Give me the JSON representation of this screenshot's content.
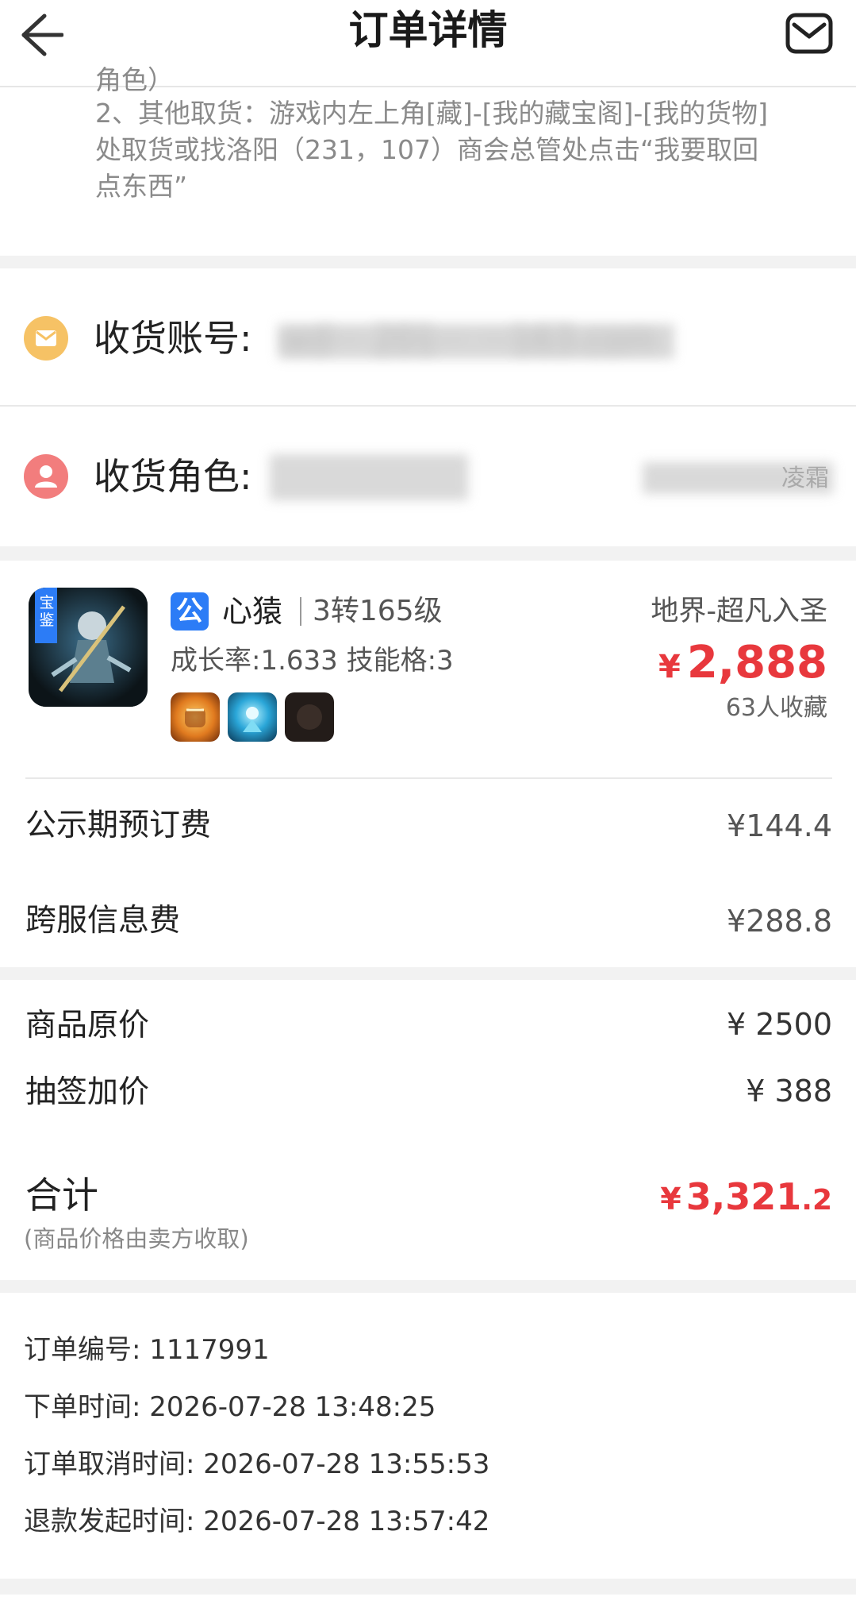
{
  "header": {
    "title": "订单详情"
  },
  "notes": {
    "line0": "角色）",
    "line1": "2、其他取货：游戏内左上角[藏]-[我的藏宝阁]-[我的货物]",
    "line2": "处取货或找洛阳（231，107）商会总管处点击“我要取回",
    "line3": "点东西”"
  },
  "receiver": {
    "account_label": "收货账号:",
    "account_value": "wd··· 201··· ···163.com",
    "role_label": "收货角色:",
    "role_value_tail": "凌霜"
  },
  "product": {
    "badge": "公",
    "name": "心猿",
    "level": "3转165级",
    "server": "地界-超凡入圣",
    "stats": "成长率:1.633 技能格:3",
    "price_symbol": "¥",
    "price": "2,888",
    "favorites": "63人收藏",
    "thumb_tag": "宝鉴",
    "skill_icons": [
      "fist-skill-icon",
      "ice-skill-icon",
      "dark-skill-icon"
    ]
  },
  "fees": [
    {
      "label": "公示期预订费",
      "value": "¥144.4"
    },
    {
      "label": "跨服信息费",
      "value": "¥288.8"
    }
  ],
  "pricing": {
    "original_label": "商品原价",
    "original_value": "¥ 2500",
    "lottery_label": "抽签加价",
    "lottery_value": "¥ 388"
  },
  "total": {
    "label": "合计",
    "note": "(商品价格由卖方收取)",
    "symbol": "¥",
    "int_part": "3,321",
    "dec_part": ".2"
  },
  "order_info": {
    "order_no": "订单编号: 1117991",
    "created": "下单时间: 2026-07-28 13:48:25",
    "cancelled": "订单取消时间: 2026-07-28 13:55:53",
    "refund": "退款发起时间: 2026-07-28 13:57:42"
  },
  "colors": {
    "accent_red": "#e8383d",
    "badge_blue": "#2c7cf6",
    "mail_icon_bg": "#f6c265",
    "role_icon_bg": "#f27d7d"
  }
}
